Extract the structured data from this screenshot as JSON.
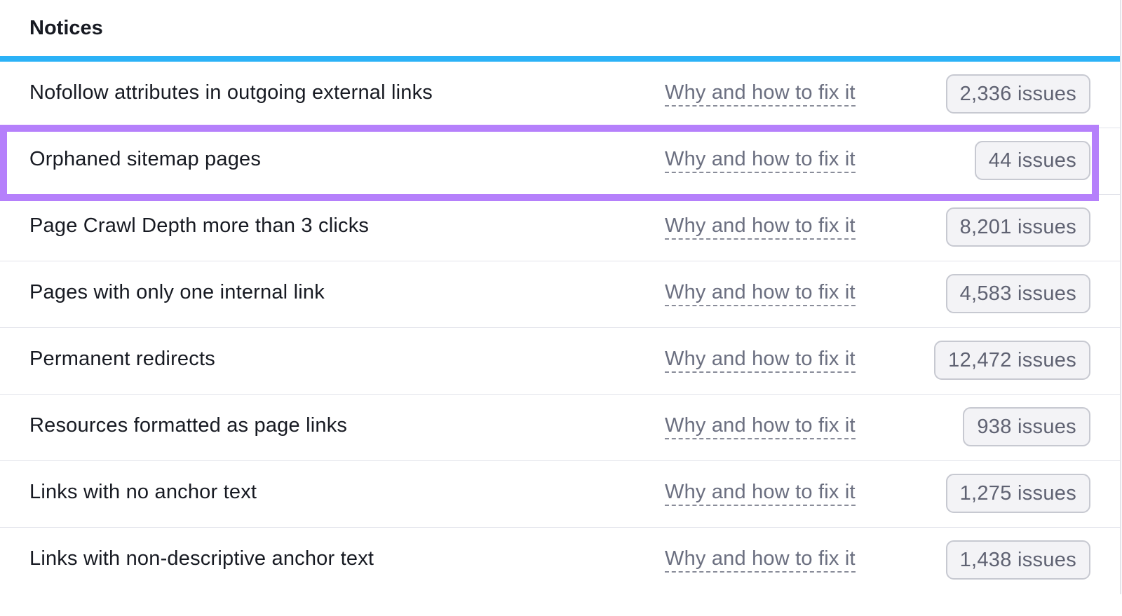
{
  "header": {
    "title": "Notices"
  },
  "colors": {
    "accent_bar": "#2bb2f7",
    "highlight": "#b580fb"
  },
  "rows": [
    {
      "title": "Nofollow attributes in outgoing external links",
      "link": "Why and how to fix it",
      "issues": "2,336 issues"
    },
    {
      "title": "Orphaned sitemap pages",
      "link": "Why and how to fix it",
      "issues": "44 issues",
      "highlighted": true
    },
    {
      "title": "Page Crawl Depth more than 3 clicks",
      "link": "Why and how to fix it",
      "issues": "8,201 issues"
    },
    {
      "title": "Pages with only one internal link",
      "link": "Why and how to fix it",
      "issues": "4,583 issues"
    },
    {
      "title": "Permanent redirects",
      "link": "Why and how to fix it",
      "issues": "12,472 issues"
    },
    {
      "title": "Resources formatted as page links",
      "link": "Why and how to fix it",
      "issues": "938 issues"
    },
    {
      "title": "Links with no anchor text",
      "link": "Why and how to fix it",
      "issues": "1,275 issues"
    },
    {
      "title": "Links with non-descriptive anchor text",
      "link": "Why and how to fix it",
      "issues": "1,438 issues"
    }
  ]
}
